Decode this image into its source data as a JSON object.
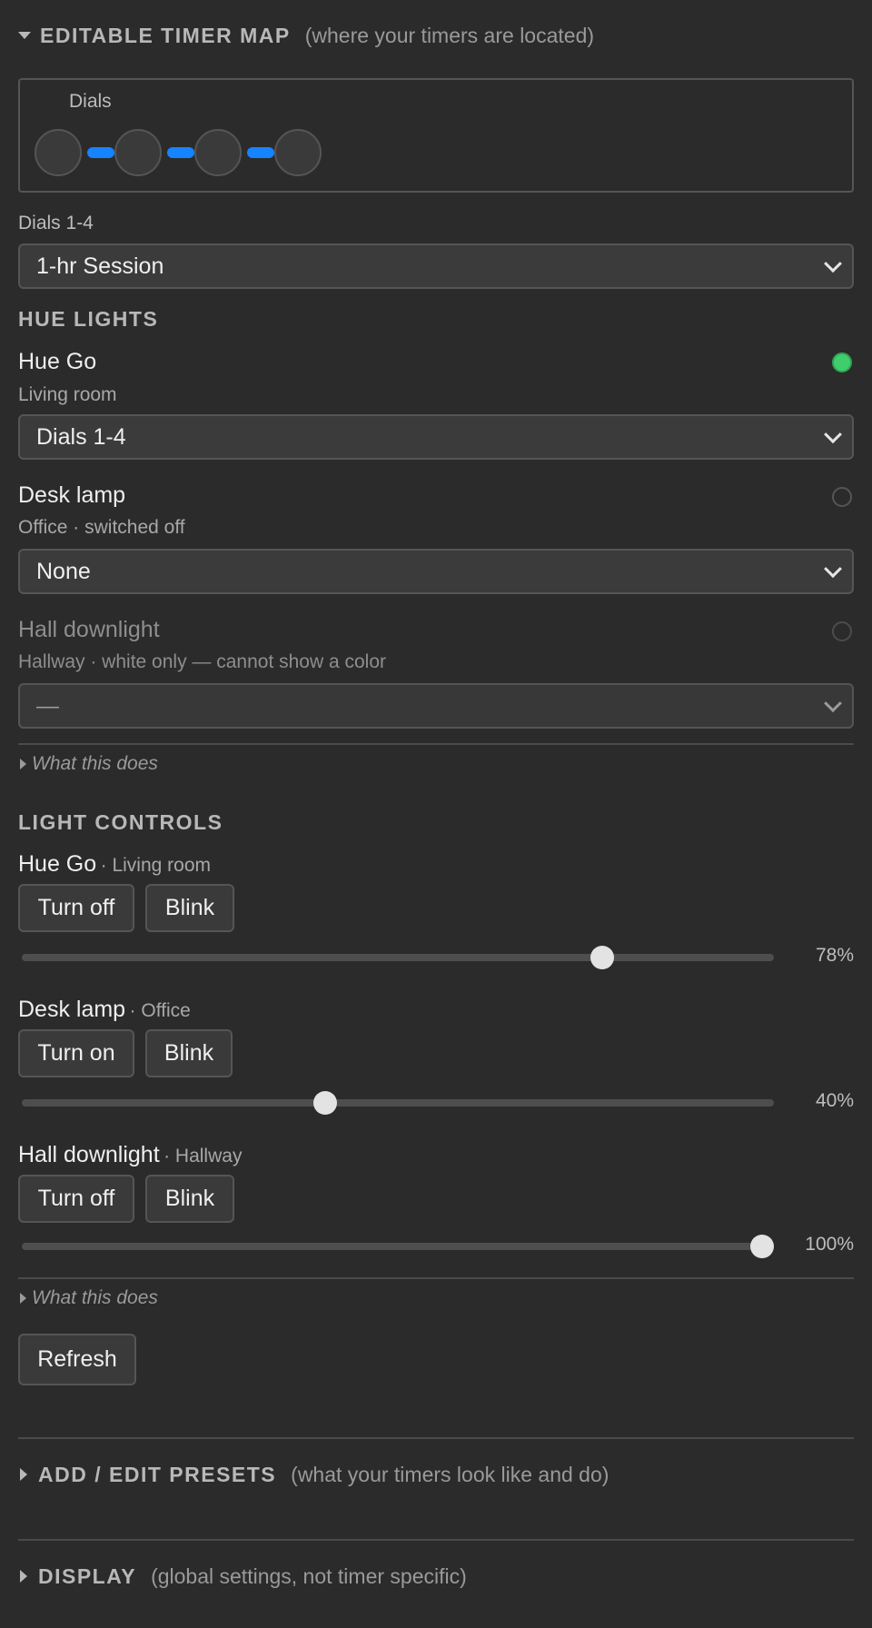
{
  "timer_map": {
    "title": "EDITABLE TIMER MAP",
    "note": "(where your timers are located)",
    "group_label": "Dials",
    "dial_count": 4,
    "link_color": "#1584ff",
    "assignment_label": "Dials 1-4",
    "assignment_value": "1-hr Session"
  },
  "hue_lights": {
    "title": "HUE LIGHTS",
    "lights": [
      {
        "name": "Hue Go",
        "sub": "Living room",
        "status": "on",
        "status_color": "#3fce6b",
        "select_value": "Dials 1-4"
      },
      {
        "name": "Desk lamp",
        "sub": "Office · switched off",
        "status": "off",
        "select_value": "None"
      },
      {
        "name": "Hall downlight",
        "sub": "Hallway · white only — cannot show a color",
        "status": "off",
        "select_value": "—"
      }
    ],
    "hint": "What this does"
  },
  "light_controls": {
    "title": "LIGHT CONTROLS",
    "items": [
      {
        "name": "Hue Go",
        "room": "· Living room",
        "toggle_label": "Turn off",
        "blink_label": "Blink",
        "brightness": 78,
        "brightness_text": "78%"
      },
      {
        "name": "Desk lamp",
        "room": "· Office",
        "toggle_label": "Turn on",
        "blink_label": "Blink",
        "brightness": 40,
        "brightness_text": "40%"
      },
      {
        "name": "Hall downlight",
        "room": "· Hallway",
        "toggle_label": "Turn off",
        "blink_label": "Blink",
        "brightness": 100,
        "brightness_text": "100%"
      }
    ],
    "hint": "What this does",
    "refresh_label": "Refresh"
  },
  "presets": {
    "title": "ADD / EDIT PRESETS",
    "note": "(what your timers look like and do)"
  },
  "display": {
    "title": "DISPLAY",
    "note": "(global settings, not timer specific)"
  }
}
